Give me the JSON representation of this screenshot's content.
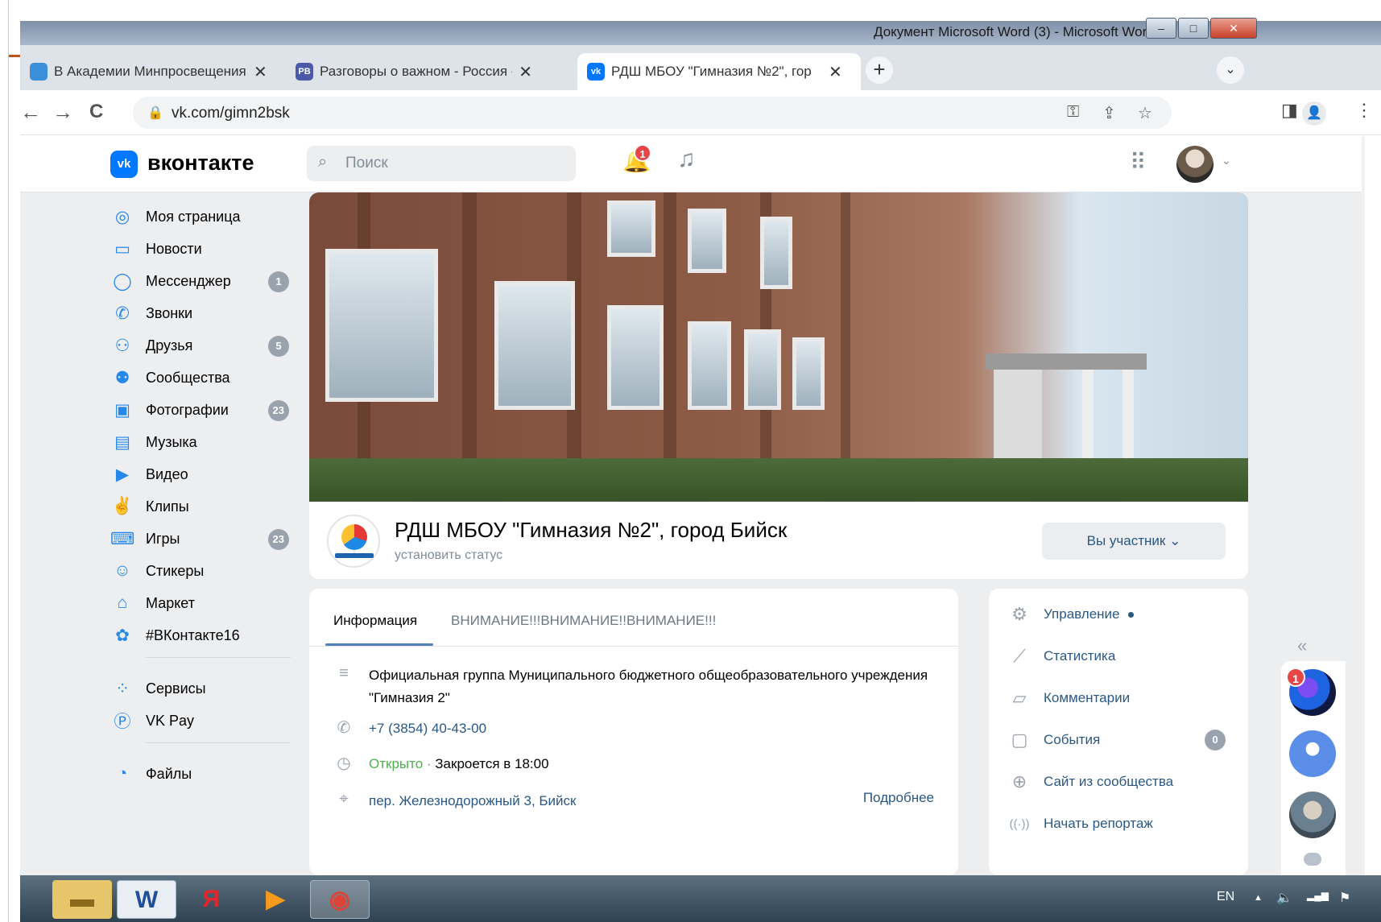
{
  "word": {
    "title": "Документ Microsoft Word (3) - Microsoft Word",
    "btn_min": "–",
    "btn_max": "□",
    "btn_close": "✕"
  },
  "browser": {
    "tabs": [
      {
        "icon_text": "",
        "title": "В Академии Минпросвещения",
        "close": "✕"
      },
      {
        "icon_text": "РВ",
        "title": "Разговоры о важном - Россия -",
        "close": "✕"
      },
      {
        "icon_text": "vk",
        "title": "РДШ МБОУ \"Гимназия №2\", гор",
        "close": "✕"
      }
    ],
    "new_tab": "+",
    "tab_menu": "⌄",
    "back": "←",
    "forward": "→",
    "reload": "C",
    "lock_icon": "🔒",
    "url": "vk.com/gimn2bsk",
    "key_icon": "⚿",
    "share_icon": "⇪",
    "star_icon": "☆",
    "sidebar_icon": "◨",
    "profile_icon": "👤",
    "menu_icon": "⋮"
  },
  "vk": {
    "logo_text": "vk",
    "brand": "вконтакте",
    "search_icon": "⌕",
    "search_placeholder": "Поиск",
    "bell_icon": "🔔",
    "bell_count": "1",
    "music_icon": "♫",
    "apps_icon": "⠿",
    "profile_chevron": "⌄",
    "nav": [
      {
        "icon": "◎",
        "label": "Моя страница",
        "count": ""
      },
      {
        "icon": "▭",
        "label": "Новости",
        "count": ""
      },
      {
        "icon": "◯",
        "label": "Мессенджер",
        "count": "1"
      },
      {
        "icon": "✆",
        "label": "Звонки",
        "count": ""
      },
      {
        "icon": "⚇",
        "label": "Друзья",
        "count": "5"
      },
      {
        "icon": "⚉",
        "label": "Сообщества",
        "count": ""
      },
      {
        "icon": "▣",
        "label": "Фотографии",
        "count": "23"
      },
      {
        "icon": "▤",
        "label": "Музыка",
        "count": ""
      },
      {
        "icon": "▶",
        "label": "Видео",
        "count": ""
      },
      {
        "icon": "✌",
        "label": "Клипы",
        "count": ""
      },
      {
        "icon": "⌨",
        "label": "Игры",
        "count": "23"
      },
      {
        "icon": "☺",
        "label": "Стикеры",
        "count": ""
      },
      {
        "icon": "⌂",
        "label": "Маркет",
        "count": ""
      },
      {
        "icon": "✿",
        "label": "#ВКонтакте16",
        "count": ""
      },
      {
        "icon": "⁘",
        "label": "Сервисы",
        "count": ""
      },
      {
        "icon": "Ⓟ",
        "label": "VK Pay",
        "count": ""
      },
      {
        "icon": "◔",
        "label": "Файлы",
        "count": ""
      }
    ],
    "group": {
      "name": "РДШ МБОУ \"Гимназия №2\", город Бийск",
      "status": "установить статус",
      "member_button": "Вы участник ⌄"
    },
    "info": {
      "tab_info": "Информация",
      "tab_attention": "ВНИМАНИЕ!!!ВНИМАНИЕ!!ВНИМАНИЕ!!!",
      "description_icon": "≡",
      "description": "Официальная группа Муниципального бюджетного общеобразовательного учреждения \"Гимназия 2\"",
      "phone_icon": "✆",
      "phone": "+7 (3854) 40-43-00",
      "clock_icon": "◷",
      "open_status": "Открыто",
      "open_sep": " · ",
      "closes": "Закроется в 18:00",
      "pin_icon": "⌖",
      "address": "пер. Железнодорожный 3, Бийск",
      "more": "Подробнее"
    },
    "side_menu": [
      {
        "icon": "⚙",
        "label": "Управление",
        "count": ""
      },
      {
        "icon": "⟋",
        "label": "Статистика",
        "count": ""
      },
      {
        "icon": "▱",
        "label": "Комментарии",
        "count": ""
      },
      {
        "icon": "▢",
        "label": "События",
        "count": "0"
      },
      {
        "icon": "⊕",
        "label": "Сайт из сообщества",
        "count": ""
      },
      {
        "icon": "((·))",
        "label": "Начать репортаж",
        "count": ""
      }
    ],
    "collapse_icon": "«",
    "chat_badge": "1"
  },
  "taskbar": {
    "apps": [
      {
        "icon": "▬",
        "name": "explorer"
      },
      {
        "icon": "W",
        "name": "word"
      },
      {
        "icon": "Я",
        "name": "yandex"
      },
      {
        "icon": "▶",
        "name": "media"
      },
      {
        "icon": "◉",
        "name": "chrome"
      }
    ],
    "lang": "EN",
    "tray_up": "▲",
    "volume": "🔈",
    "network": "▂▄▆",
    "flag": "⚑"
  }
}
